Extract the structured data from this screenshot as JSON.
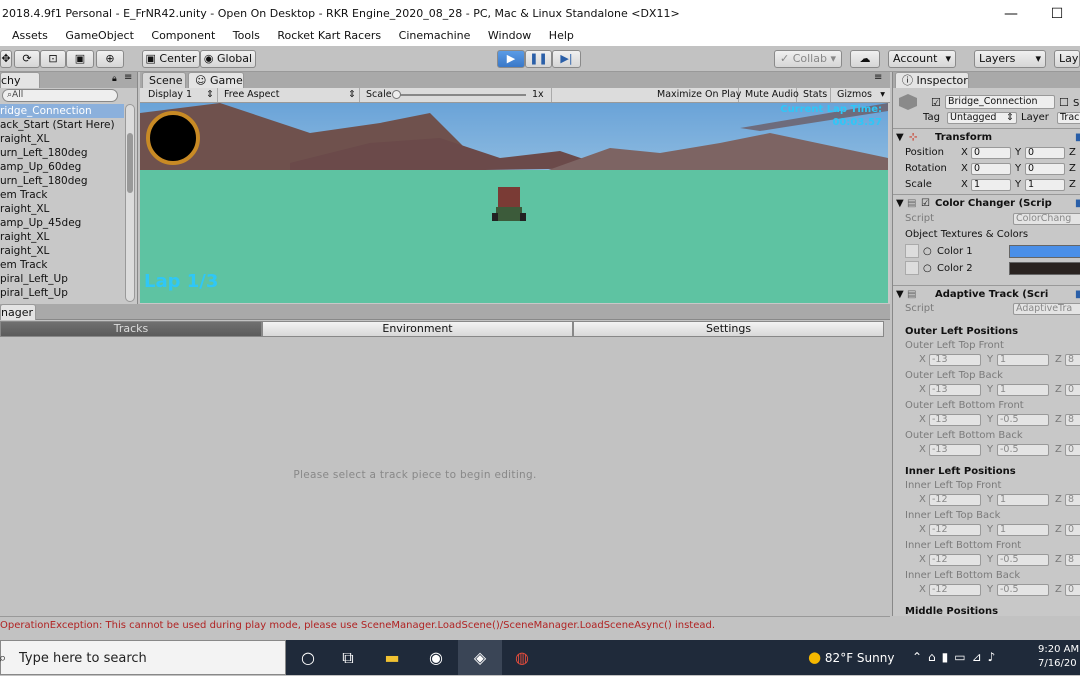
{
  "titlebar": {
    "title": "2018.4.9f1 Personal - E_FrNR42.unity - Open On Desktop - RKR Engine_2020_08_28 - PC, Mac & Linux Standalone <DX11>",
    "minimize": "—",
    "maximize": "☐"
  },
  "menu": [
    "Assets",
    "GameObject",
    "Component",
    "Tools",
    "Rocket Kart Racers",
    "Cinemachine",
    "Window",
    "Help"
  ],
  "toolbar": {
    "pivot": "Center",
    "space": "Global",
    "collab": "Collab",
    "account": "Account",
    "layers": "Layers",
    "layout": "Layo"
  },
  "hierarchy": {
    "tab": "chy",
    "search_placeholder": "All",
    "items": [
      "ridge_Connection",
      "ack_Start (Start Here)",
      "raight_XL",
      "urn_Left_180deg",
      "amp_Up_60deg",
      "urn_Left_180deg",
      "em Track",
      "raight_XL",
      "amp_Up_45deg",
      "raight_XL",
      "raight_XL",
      "em Track",
      "piral_Left_Up",
      "piral_Left_Up"
    ]
  },
  "game": {
    "tab_scene": "Scene",
    "tab_game": "Game",
    "display": "Display 1",
    "aspect": "Free Aspect",
    "scale_label": "Scale",
    "scale_value": "1x",
    "scale_fraction": 0.0,
    "maximize_on_play": "Maximize On Play",
    "mute_audio": "Mute Audio",
    "stats": "Stats",
    "gizmos": "Gizmos",
    "lap": "Lap 1/3",
    "lap_time_label": "Current Lap Time:",
    "lap_time_value": "00:03.57"
  },
  "manager": {
    "tab": "nager",
    "tabs": [
      "Tracks",
      "Environment",
      "Settings"
    ],
    "message": "Please select a track piece to begin editing."
  },
  "status": {
    "error": "OperationException: This cannot be used during play mode, please use SceneManager.LoadScene()/SceneManager.LoadSceneAsync() instead."
  },
  "inspector": {
    "tab": "Inspector",
    "object_name": "Bridge_Connection",
    "static_label": "S",
    "tag_label": "Tag",
    "tag_value": "Untagged",
    "layer_label": "Layer",
    "layer_value": "Trac",
    "transform": {
      "title": "Transform",
      "position_label": "Position",
      "rotation_label": "Rotation",
      "scale_label": "Scale",
      "position": [
        "0",
        "0",
        ""
      ],
      "rotation": [
        "0",
        "0",
        ""
      ],
      "scale": [
        "1",
        "1",
        ""
      ]
    },
    "color_changer": {
      "title": "Color Changer (Scrip",
      "script_label": "Script",
      "script_value": "ColorChang",
      "textures_label": "Object Textures & Colors",
      "color1_label": "Color 1",
      "color2_label": "Color 2",
      "color1": "#4a8fe8",
      "color2": "#2a2320"
    },
    "adaptive_track": {
      "title": "Adaptive Track (Scri",
      "script_label": "Script",
      "script_value": "AdaptiveTra",
      "outer_header": "Outer Left Positions",
      "outer": [
        {
          "label": "Outer Left Top Front",
          "x": "-13",
          "y": "1",
          "z": "8"
        },
        {
          "label": "Outer Left Top Back",
          "x": "-13",
          "y": "1",
          "z": "0"
        },
        {
          "label": "Outer Left Bottom Front",
          "x": "-13",
          "y": "-0.5",
          "z": "8"
        },
        {
          "label": "Outer Left Bottom Back",
          "x": "-13",
          "y": "-0.5",
          "z": "0"
        }
      ],
      "inner_header": "Inner Left Positions",
      "inner": [
        {
          "label": "Inner Left Top Front",
          "x": "-12",
          "y": "1",
          "z": "8"
        },
        {
          "label": "Inner Left Top Back",
          "x": "-12",
          "y": "1",
          "z": "0"
        },
        {
          "label": "Inner Left Bottom Front",
          "x": "-12",
          "y": "-0.5",
          "z": "8"
        },
        {
          "label": "Inner Left Bottom Back",
          "x": "-12",
          "y": "-0.5",
          "z": "0"
        }
      ],
      "middle_header": "Middle Positions"
    }
  },
  "taskbar": {
    "search_placeholder": "Type here to search",
    "weather": "82°F  Sunny",
    "time": "9:20 AM",
    "date": "7/16/20"
  }
}
